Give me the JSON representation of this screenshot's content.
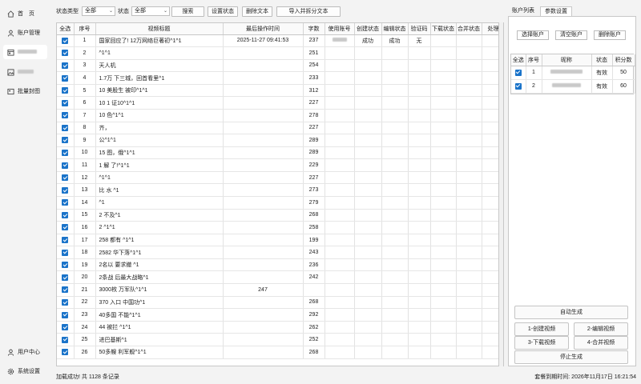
{
  "sidebar": {
    "items": [
      {
        "label": "首　页",
        "icon": "home-icon"
      },
      {
        "label": "账户管理",
        "icon": "user-icon"
      },
      {
        "label": "",
        "icon": "calendar-icon"
      },
      {
        "label": "",
        "icon": "image-icon"
      },
      {
        "label": "批量封图",
        "icon": "cover-icon"
      }
    ],
    "bottom": [
      {
        "label": "用户中心",
        "icon": "person-icon"
      },
      {
        "label": "系统设置",
        "icon": "gear-icon"
      }
    ]
  },
  "toolbar": {
    "status_type_label": "状态类型",
    "status_type_value": "全部",
    "status_label": "状态",
    "status_value": "全部",
    "search_label": "搜索",
    "set_status_label": "设置状态",
    "delete_text_label": "删除文本",
    "import_split_label": "导入并拆分文本"
  },
  "table": {
    "columns": [
      "全选",
      "序号",
      "视频标题",
      "最后操作时间",
      "字数",
      "使用账号",
      "创建状态",
      "编辑状态",
      "验证码",
      "下载状态",
      "合并状态",
      "处理信息"
    ],
    "rows": [
      {
        "no": "1",
        "title": "国家回应了! 12万网络巨著初^1^1",
        "time": "2025-11-27 09:41:53",
        "chars": "237",
        "account": "",
        "create": "成功",
        "edit": "成功",
        "captcha": "无"
      },
      {
        "no": "2",
        "title": "^1^1",
        "time": "",
        "chars": "251"
      },
      {
        "no": "3",
        "title": "天人机",
        "time": "",
        "chars": "254"
      },
      {
        "no": "4",
        "title": "1.7万 下三城，回首看里^1",
        "time": "",
        "chars": "233"
      },
      {
        "no": "5",
        "title": "10 美股生 被印^1^1",
        "time": "",
        "chars": "312"
      },
      {
        "no": "6",
        "title": "10 1 证10^1^1",
        "time": "",
        "chars": "227"
      },
      {
        "no": "7",
        "title": "10 色^1^1",
        "time": "",
        "chars": "278"
      },
      {
        "no": "8",
        "title": "齐，",
        "time": "",
        "chars": "227"
      },
      {
        "no": "9",
        "title": "公^1^1",
        "time": "",
        "chars": "289"
      },
      {
        "no": "10",
        "title": "15 图，俄^1^1",
        "time": "",
        "chars": "289"
      },
      {
        "no": "11",
        "title": "1 解 了!^1^1",
        "time": "",
        "chars": "229"
      },
      {
        "no": "12",
        "title": "^1^1",
        "time": "",
        "chars": "227"
      },
      {
        "no": "13",
        "title": "比 水 ^1",
        "time": "",
        "chars": "273"
      },
      {
        "no": "14",
        "title": "^1",
        "time": "",
        "chars": "279"
      },
      {
        "no": "15",
        "title": "2 不及^1",
        "time": "",
        "chars": "268"
      },
      {
        "no": "16",
        "title": "2 ^1^1",
        "time": "",
        "chars": "258"
      },
      {
        "no": "17",
        "title": "258 都有 ^1^1",
        "time": "",
        "chars": "199"
      },
      {
        "no": "18",
        "title": "2582 华下落^1^1",
        "time": "",
        "chars": "243"
      },
      {
        "no": "19",
        "title": "2名以 要求撤 ^1",
        "time": "",
        "chars": "236"
      },
      {
        "no": "20",
        "title": "2条战 后最大战略^1",
        "time": "",
        "chars": "242"
      },
      {
        "no": "21",
        "title": "3000枚 万军队^1^1",
        "time": "247"
      },
      {
        "no": "22",
        "title": "370 入口 中国功^1",
        "time": "",
        "chars": "268"
      },
      {
        "no": "23",
        "title": "40多国 不能^1^1",
        "time": "",
        "chars": "292"
      },
      {
        "no": "24",
        "title": "44 被拦 ^1^1",
        "time": "",
        "chars": "262"
      },
      {
        "no": "25",
        "title": "进巴基斯^1",
        "time": "",
        "chars": "252"
      },
      {
        "no": "26",
        "title": "50多艘 利军舰^1^1",
        "time": "",
        "chars": "268"
      }
    ]
  },
  "right_panel": {
    "tabs": [
      "账户列表",
      "参数设置"
    ],
    "select_account_label": "选择账户",
    "clear_account_label": "清空账户",
    "delete_account_label": "删除账户",
    "account_columns": [
      "全选",
      "序号",
      "昵称",
      "状态",
      "积分数"
    ],
    "accounts": [
      {
        "no": "1",
        "nickname": "",
        "status": "有效",
        "points": "50"
      },
      {
        "no": "2",
        "nickname": "",
        "status": "有效",
        "points": "60"
      }
    ],
    "auto_generate_label": "自动生成",
    "step1_label": "1-创建视频",
    "step2_label": "2-编辑视频",
    "step3_label": "3-下载视频",
    "step4_label": "4-合并视频",
    "stop_label": "停止生成"
  },
  "status_bar": {
    "left": "加载成功! 共 1128 条记录",
    "right": "套餐到期时间: 2026年11月17日 16:21:54"
  },
  "colors": {
    "checkbox": "#1a73c9",
    "accent": "#1a73c9"
  }
}
